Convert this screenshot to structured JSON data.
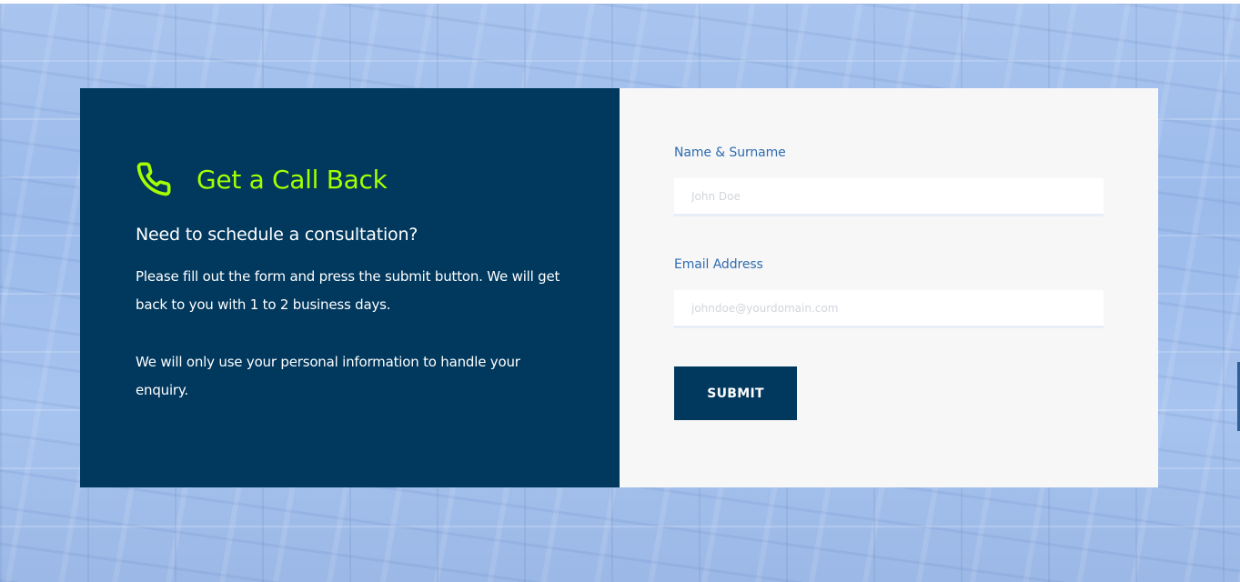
{
  "callback": {
    "title": "Get a Call Back",
    "icon": "phone-icon",
    "subtitle": "Need to schedule a consultation?",
    "paragraph1": "Please fill out the form and press the submit button. We will get back to you with 1 to 2 business days.",
    "paragraph2": "We will only use your personal information to handle your enquiry."
  },
  "form": {
    "name_label": "Name & Surname",
    "name_placeholder": "John Doe",
    "email_label": "Email Address",
    "email_placeholder": "johndoe@yourdomain.com",
    "submit_label": "SUBMIT"
  },
  "colors": {
    "panel_dark": "#00385e",
    "accent": "#a4ff00",
    "label": "#2f6cb0",
    "form_bg": "#f7f7f7"
  }
}
